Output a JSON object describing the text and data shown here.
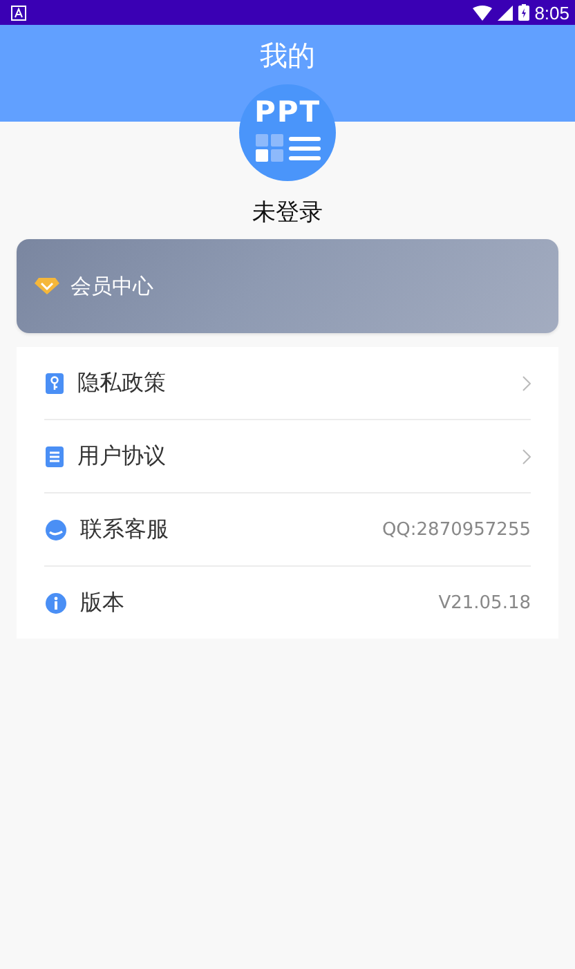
{
  "status_bar": {
    "time": "8:05"
  },
  "header": {
    "title": "我的"
  },
  "profile": {
    "logo_text": "PPT",
    "login_status": "未登录"
  },
  "member_card": {
    "label": "会员中心"
  },
  "menu": [
    {
      "label": "隐私政策",
      "kind": "link"
    },
    {
      "label": "用户协议",
      "kind": "link"
    },
    {
      "label": "联系客服",
      "kind": "value",
      "value": "QQ:2870957255"
    },
    {
      "label": "版本",
      "kind": "value",
      "value": "V21.05.18"
    }
  ]
}
